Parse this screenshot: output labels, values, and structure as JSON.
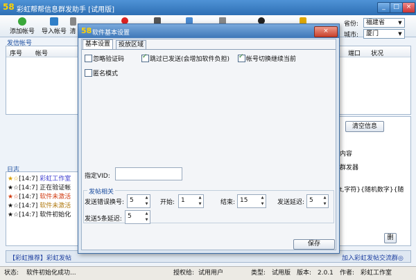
{
  "app": {
    "logo": "58",
    "title": "彩虹帮帮信息群发助手 [试用版]"
  },
  "toolbar": {
    "add_account": "添加帐号",
    "import_account": "导入帐号",
    "partial_label": "清"
  },
  "location": {
    "province_label": "省份:",
    "province_value": "福建省",
    "city_label": "城市:",
    "city_value": "厦门"
  },
  "accounts": {
    "title": "发信帐号",
    "col_seq": "序号",
    "col_account": "帐号",
    "col_port": "端口",
    "col_status": "状况"
  },
  "right_panel": {
    "clear_button": "清空信息",
    "partial_1": "内容",
    "partial_2": "群发器",
    "partial_3": "t,字符}{随机数字}{随",
    "small_button": "删"
  },
  "log": {
    "title": "日志",
    "lines": [
      {
        "prefix": "★☆",
        "time": "[14:7]",
        "text": "彩虹工作室",
        "color": "#3c3ccf"
      },
      {
        "prefix": "★☆",
        "time": "[14:7]",
        "text": "正在验证帐",
        "color": "#111111"
      },
      {
        "prefix": "★☆",
        "time": "[14:7]",
        "text": "软件未激活",
        "color": "#d03a10"
      },
      {
        "prefix": "★☆",
        "time": "[14:7]",
        "text": "软件未激活",
        "color": "#b07a10"
      },
      {
        "prefix": "★☆",
        "time": "[14:7]",
        "text": "软件初始化",
        "color": "#111111"
      }
    ]
  },
  "bottom_banner": {
    "left": "【彩虹推荐】彩虹发帖",
    "right": "加入彩虹发帖交流群◎"
  },
  "statusbar": {
    "status_label": "状态:",
    "status_value": "软件初始化成功...",
    "auth_label": "授权给:",
    "auth_value": "试用用户",
    "type_label": "类型:",
    "type_value": "试用版",
    "version_label": "版本:",
    "version_value": "2.0.1",
    "author_label": "作者:",
    "author_value": "彩虹工作室"
  },
  "dialog": {
    "logo": "58",
    "title": "软件基本设置",
    "tabs": [
      "基本设置",
      "投放区域"
    ],
    "options": {
      "ignore_captcha": "忽略验证码",
      "skip_sent": "跳过已发送(会增加软件负担)",
      "continue_on_switch": "帐号切换继续当前",
      "anonymous": "匿名模式"
    },
    "vid_label": "指定VID:",
    "vid_value": "",
    "group_title": "发帖相关",
    "send_error_label": "发送错误换号:",
    "send_error_value": "5",
    "start_label": "开始:",
    "start_value": "1",
    "end_label": "结束:",
    "end_value": "15",
    "send_delay_label": "发送延迟:",
    "send_delay_value": "5",
    "per5_delay_label": "发送5条延迟:",
    "per5_delay_value": "5",
    "save_button": "保存"
  },
  "colors": {
    "title_bar": "#3d77b8",
    "accent_text": "#1d4fa0",
    "logo_color": "#ffd200"
  }
}
